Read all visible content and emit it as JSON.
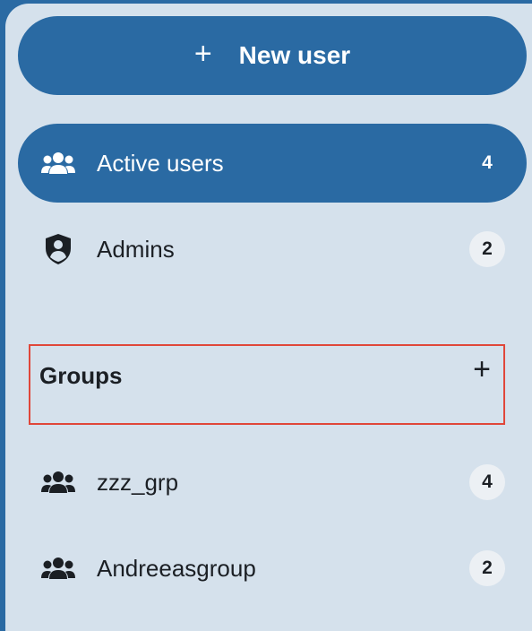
{
  "new_user": {
    "plus": "+",
    "label": "New user"
  },
  "nav": {
    "active_users": {
      "label": "Active users",
      "count": "4",
      "icon": "users-icon"
    },
    "admins": {
      "label": "Admins",
      "count": "2",
      "icon": "shield-user-icon"
    }
  },
  "groups": {
    "title": "Groups",
    "add_glyph": "+",
    "items": [
      {
        "label": "zzz_grp",
        "count": "4",
        "icon": "users-icon"
      },
      {
        "label": "Andreeasgroup",
        "count": "2",
        "icon": "users-icon"
      }
    ]
  },
  "colors": {
    "primary": "#2a6aa3",
    "panel_bg": "#d5e1ec",
    "text": "#1b1f24",
    "highlight_border": "#e0473a",
    "badge_bg": "#ecf0f4"
  }
}
